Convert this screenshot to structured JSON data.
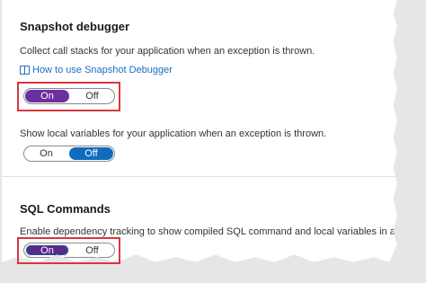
{
  "snapshot": {
    "heading": "Snapshot debugger",
    "description": "Collect call stacks for your application when an exception is thrown.",
    "link": "How to use Snapshot Debugger",
    "toggle": {
      "on": "On",
      "off": "Off",
      "selected": "On"
    }
  },
  "local_vars": {
    "description": "Show local variables for your application when an exception is thrown.",
    "toggle": {
      "on": "On",
      "off": "Off",
      "selected": "Off"
    }
  },
  "sql": {
    "heading": "SQL Commands",
    "description": "Enable dependency tracking to show compiled SQL command and local variables in a web reque",
    "toggle": {
      "on": "On",
      "off": "Off",
      "selected": "On"
    }
  },
  "colors": {
    "accent_purple": "#6b2fa0",
    "accent_blue": "#0f6cbd",
    "highlight_red": "#d9363e"
  }
}
